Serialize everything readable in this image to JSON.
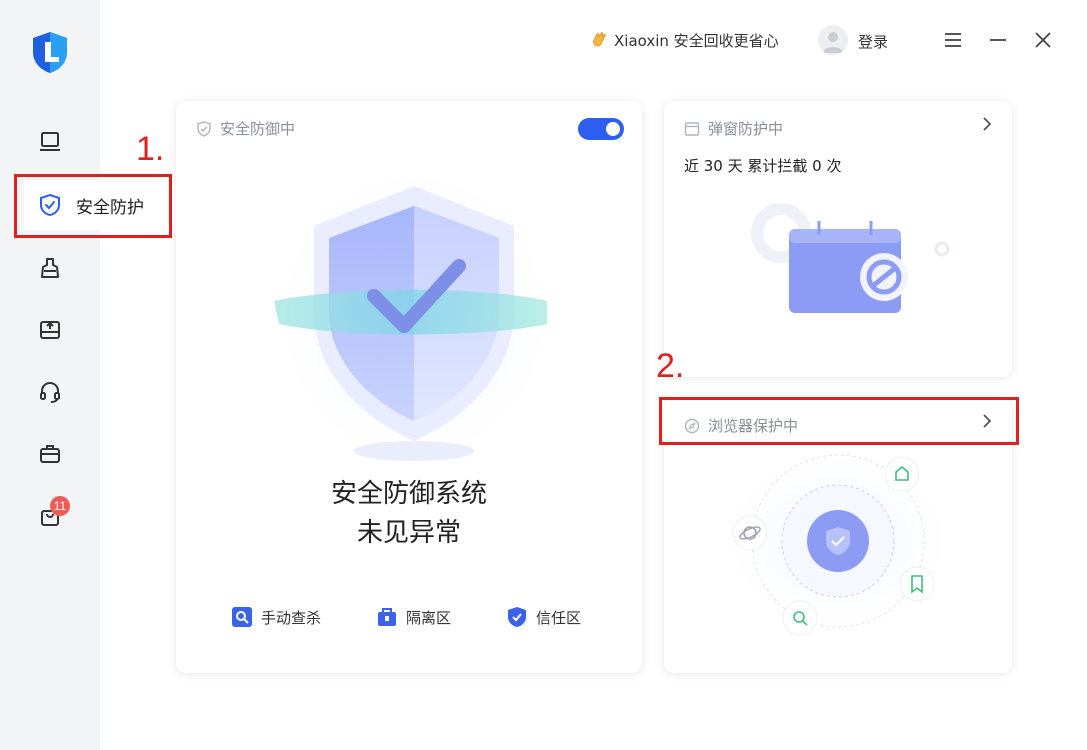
{
  "sidebar": {
    "active_label": "安全防护",
    "badge_count": "11",
    "icons": [
      "laptop-icon",
      "shield-check-icon",
      "broom-icon",
      "drive-icon",
      "headset-icon",
      "toolbox-icon",
      "bag-icon"
    ]
  },
  "titlebar": {
    "slogan": "Xiaoxin 安全回收更省心",
    "login_label": "登录"
  },
  "annotations": {
    "step1": "1.",
    "step2": "2."
  },
  "defense_card": {
    "title": "安全防御中",
    "toggle_on": true,
    "status_line1": "安全防御系统",
    "status_line2": "未见异常",
    "tools": [
      "手动查杀",
      "隔离区",
      "信任区"
    ]
  },
  "popup_card": {
    "title": "弹窗防护中",
    "stat": "近 30 天 累计拦截 0 次"
  },
  "browser_card": {
    "title": "浏览器保护中"
  },
  "colors": {
    "accent": "#2d5ef0",
    "annotation_red": "#e0201f",
    "green_icon": "#3cc07a"
  }
}
